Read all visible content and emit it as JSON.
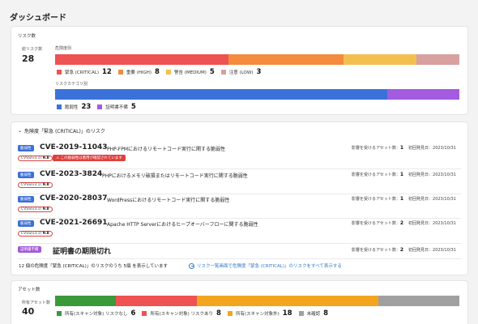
{
  "page_title": "ダッシュボード",
  "risk": {
    "section_label": "リスク数",
    "total_label": "総リスク数",
    "total": "28",
    "severity_label": "危険度別",
    "severity": [
      {
        "name": "緊急 (CRITICAL)",
        "count": "12",
        "value": 12,
        "color": "#ee5253"
      },
      {
        "name": "重要 (HIGH)",
        "count": "8",
        "value": 8,
        "color": "#f48b3e"
      },
      {
        "name": "警告 (MEDIUM)",
        "count": "5",
        "value": 5,
        "color": "#f3c04f"
      },
      {
        "name": "注意 (LOW)",
        "count": "3",
        "value": 3,
        "color": "#d9a0a0"
      }
    ],
    "category_label": "リスクカテゴリ別",
    "category": [
      {
        "name": "脆弱性",
        "count": "23",
        "value": 23,
        "color": "#3b72d9"
      },
      {
        "name": "証明書不備",
        "count": "5",
        "value": 5,
        "color": "#a35be0"
      }
    ]
  },
  "critical": {
    "header": "危険度「緊急 (CRITICAL)」のリスク",
    "items": [
      {
        "badge": "脆弱性",
        "id": "CVE-2019-11043",
        "title": "PHP-FPMにおけるリモートコード実行に関する脆弱性",
        "cvss_label": "CVSS(v3.1)",
        "cvss": "9.8",
        "warning": "この脆弱性は悪用が確認されています",
        "assets_label": "影響を受けるアセット数：",
        "assets": "1",
        "first_label": "初回発見日：",
        "first": "2023/10/31"
      },
      {
        "badge": "脆弱性",
        "id": "CVE-2023-3824",
        "title": "PHPにおけるメモリ破損またはリモートコード実行に関する脆弱性",
        "cvss_label": "CVSS(v3.1)",
        "cvss": "9.8",
        "assets_label": "影響を受けるアセット数：",
        "assets": "1",
        "first_label": "初回発見日：",
        "first": "2023/10/31"
      },
      {
        "badge": "脆弱性",
        "id": "CVE-2020-28037",
        "title": "WordPressにおけるリモートコード実行に関する脆弱性",
        "cvss_label": "CVSS(v3.1)",
        "cvss": "9.8",
        "assets_label": "影響を受けるアセット数：",
        "assets": "1",
        "first_label": "初回発見日：",
        "first": "2023/10/31"
      },
      {
        "badge": "脆弱性",
        "id": "CVE-2021-26691",
        "title": "Apache HTTP Serverにおけるヒープオーバーフローに関する脆弱性",
        "cvss_label": "CVSS(v3.1)",
        "cvss": "9.8",
        "assets_label": "影響を受けるアセット数：",
        "assets": "2",
        "first_label": "初回発見日：",
        "first": "2023/10/31"
      },
      {
        "badge": "証明書不備",
        "id": "証明書の期限切れ",
        "assets_label": "影響を受けるアセット数：",
        "assets": "2",
        "first_label": "初回発見日：",
        "first": "2023/10/31"
      }
    ],
    "summary": "12 個の危険度「緊急 (CRITICAL)」のリスクのうち 5個 を表示しています",
    "link": "リスク一覧画面で危険度「緊急 (CRITICAL)」のリスクをすべて表示する"
  },
  "assets": {
    "section_label": "アセット数",
    "total_label": "所有アセット数",
    "total": "40",
    "segments": [
      {
        "name": "所有(スキャン対象) リスクなし",
        "count": "6",
        "value": 6,
        "color": "#3a9a3a"
      },
      {
        "name": "所有(スキャン対象) リスクあり",
        "count": "8",
        "value": 8,
        "color": "#ee5253"
      },
      {
        "name": "所有(スキャン対象外)",
        "count": "18",
        "value": 18,
        "color": "#f3a51e"
      },
      {
        "name": "未確認",
        "count": "8",
        "value": 8,
        "color": "#a0a0a0"
      }
    ]
  }
}
